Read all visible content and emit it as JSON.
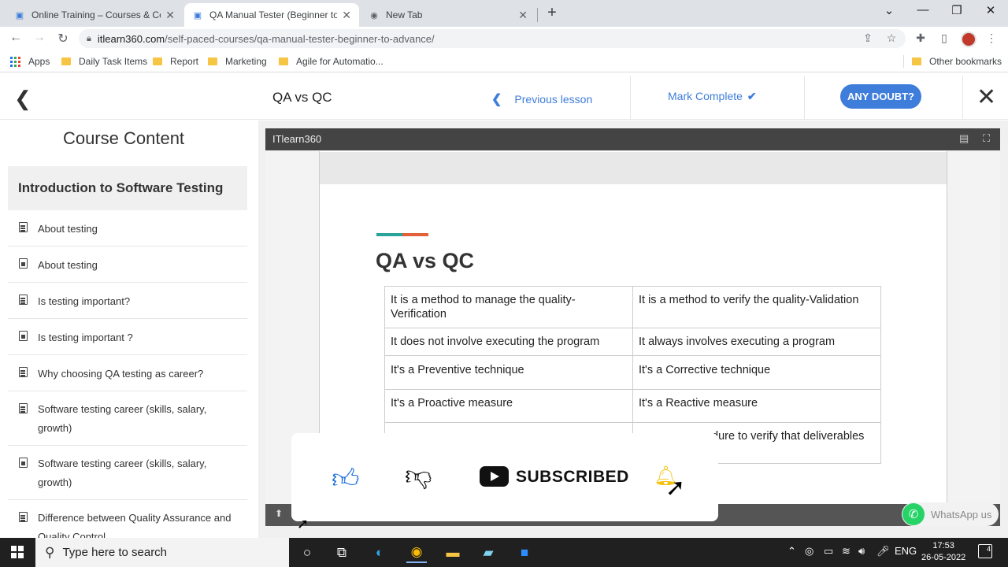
{
  "browser": {
    "tabs": [
      {
        "title": "Online Training – Courses & Cert",
        "active": false
      },
      {
        "title": "QA Manual Tester (Beginner to A",
        "active": true
      },
      {
        "title": "New Tab",
        "active": false
      }
    ],
    "url_domain": "itlearn360.com",
    "url_path": "/self-paced-courses/qa-manual-tester-beginner-to-advance/",
    "bookmarks": [
      "Apps",
      "Daily Task Items",
      "Report",
      "Marketing",
      "Agile for Automatio..."
    ],
    "other_bookmarks": "Other bookmarks"
  },
  "course_header": {
    "lesson_title": "QA vs QC",
    "previous_lesson": "Previous lesson",
    "mark_complete": "Mark Complete",
    "doubt_button": "ANY DOUBT?"
  },
  "sidebar": {
    "title": "Course Content",
    "section": "Introduction to Software Testing",
    "lessons": [
      {
        "label": "About testing",
        "type": "text"
      },
      {
        "label": "About testing",
        "type": "video"
      },
      {
        "label": "Is testing important?",
        "type": "text"
      },
      {
        "label": "Is testing important ?",
        "type": "video"
      },
      {
        "label": "Why choosing QA testing as career?",
        "type": "text"
      },
      {
        "label": "Software testing career (skills, salary, growth)",
        "type": "text"
      },
      {
        "label": "Software testing career (skills, salary, growth)",
        "type": "video"
      },
      {
        "label": "Difference between Quality Assurance and Quality Control",
        "type": "text"
      }
    ]
  },
  "player": {
    "brand": "ITlearn360",
    "slide_title": "QA vs QC",
    "table": [
      [
        "It is a method to manage the quality-Verification",
        "It is a method to verify the quality-Validation"
      ],
      [
        "It does not involve executing the program",
        "It always involves executing a program"
      ],
      [
        "It's a Preventive technique",
        "It's a Corrective technique"
      ],
      [
        "It's a Proactive measure",
        "It's a Reactive measure"
      ],
      [
        "",
        "dure to verify that deliverables"
      ]
    ]
  },
  "overlay": {
    "subscribed": "SUBSCRIBED"
  },
  "whatsapp": "WhatsApp us",
  "taskbar": {
    "search_placeholder": "Type here to search",
    "language": "ENG",
    "time": "17:53",
    "date": "26-05-2022",
    "notifications": "4"
  },
  "colors": {
    "accent_blue": "#3f7ddb",
    "thumb_blue": "#1f6fe0",
    "whatsapp_green": "#25d366"
  }
}
